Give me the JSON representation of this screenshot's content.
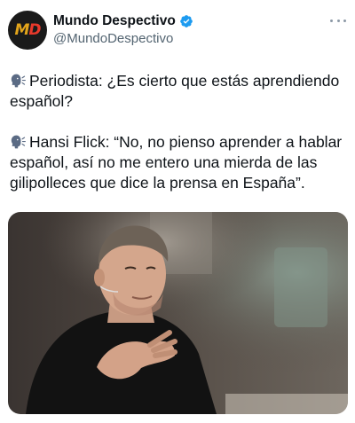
{
  "tweet": {
    "author": {
      "display_name": "Mundo Despectivo",
      "handle": "@MundoDespectivo",
      "avatar_text": "MD",
      "verified": true
    },
    "paragraphs": [
      {
        "icon": "speaking-head-icon",
        "text": "Periodista: ¿Es cierto que estás aprendiendo español?"
      },
      {
        "icon": "speaking-head-icon",
        "text": "Hansi Flick: “No, no pienso aprender a hablar español, así no me entero una mierda de las gilipolleces que dice la prensa en España”."
      }
    ],
    "media": {
      "description_icon": "photo"
    }
  },
  "colors": {
    "verified": "#1d9bf0",
    "text": "#0f1419",
    "secondary": "#536471",
    "avatar_bg": "#1a1a1a",
    "avatar_m": "#e3a51b",
    "avatar_d": "#e8392b"
  }
}
